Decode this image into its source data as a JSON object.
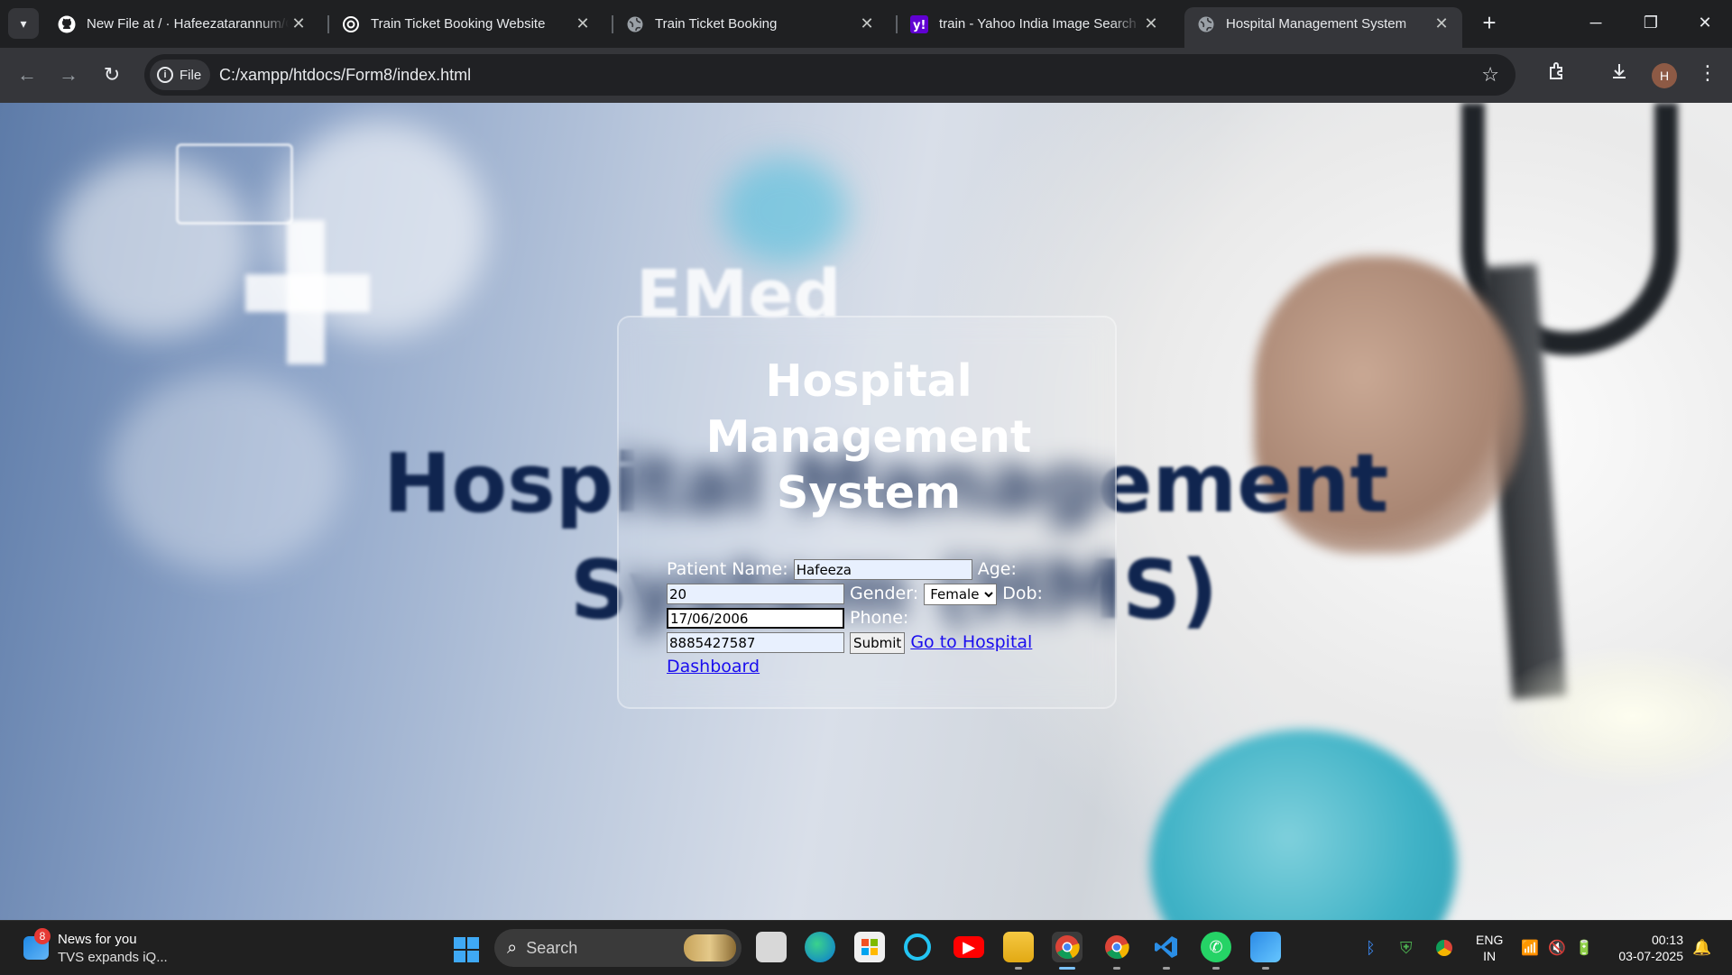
{
  "browser": {
    "tabs": [
      {
        "title": "New File at / · Hafeezatarannum/C",
        "icon": "github-icon",
        "active": false
      },
      {
        "title": "Train Ticket Booking Website",
        "icon": "openai-icon",
        "active": false
      },
      {
        "title": "Train Ticket Booking",
        "icon": "globe-icon",
        "active": false
      },
      {
        "title": "train - Yahoo India Image Search r",
        "icon": "yahoo-icon",
        "active": false
      },
      {
        "title": "Hospital Management System",
        "icon": "globe-icon",
        "active": true
      }
    ],
    "address": {
      "chip_label": "File",
      "url": "C:/xampp/htdocs/Form8/index.html"
    },
    "profile_initial": "H"
  },
  "page": {
    "background_text_line1": "Hospital Management",
    "background_text_line2": "System (HMS)",
    "background_logo_text": "EMed",
    "title_line1": "Hospital",
    "title_line2": "Management",
    "title_line3": "System",
    "form": {
      "patient_name_label": "Patient Name:",
      "patient_name_value": "Hafeeza",
      "age_label": "Age:",
      "age_value": "20",
      "gender_label": "Gender:",
      "gender_value": "Female",
      "dob_label": "Dob:",
      "dob_value": "17/06/2006",
      "phone_label": "Phone:",
      "phone_value": "8885427587",
      "submit_label": "Submit",
      "dashboard_link_line1": "Go to Hospital",
      "dashboard_link_line2": "Dashboard"
    }
  },
  "taskbar": {
    "news_badge": "8",
    "news_title": "News for you",
    "news_subtitle": "TVS expands iQ...",
    "search_label": "Search",
    "lang_line1": "ENG",
    "lang_line2": "IN",
    "time": "00:13",
    "date": "03-07-2025",
    "apps": [
      "task-view-icon",
      "edge-icon",
      "store-icon",
      "cortana-icon",
      "youtube-icon",
      "file-explorer-icon",
      "chrome-icon",
      "chrome-profile-icon",
      "vscode-icon",
      "whatsapp-icon",
      "photos-icon"
    ]
  },
  "colors": {
    "link": "#1a0dee",
    "tab_active": "#35363a",
    "taskbar": "#202020"
  }
}
